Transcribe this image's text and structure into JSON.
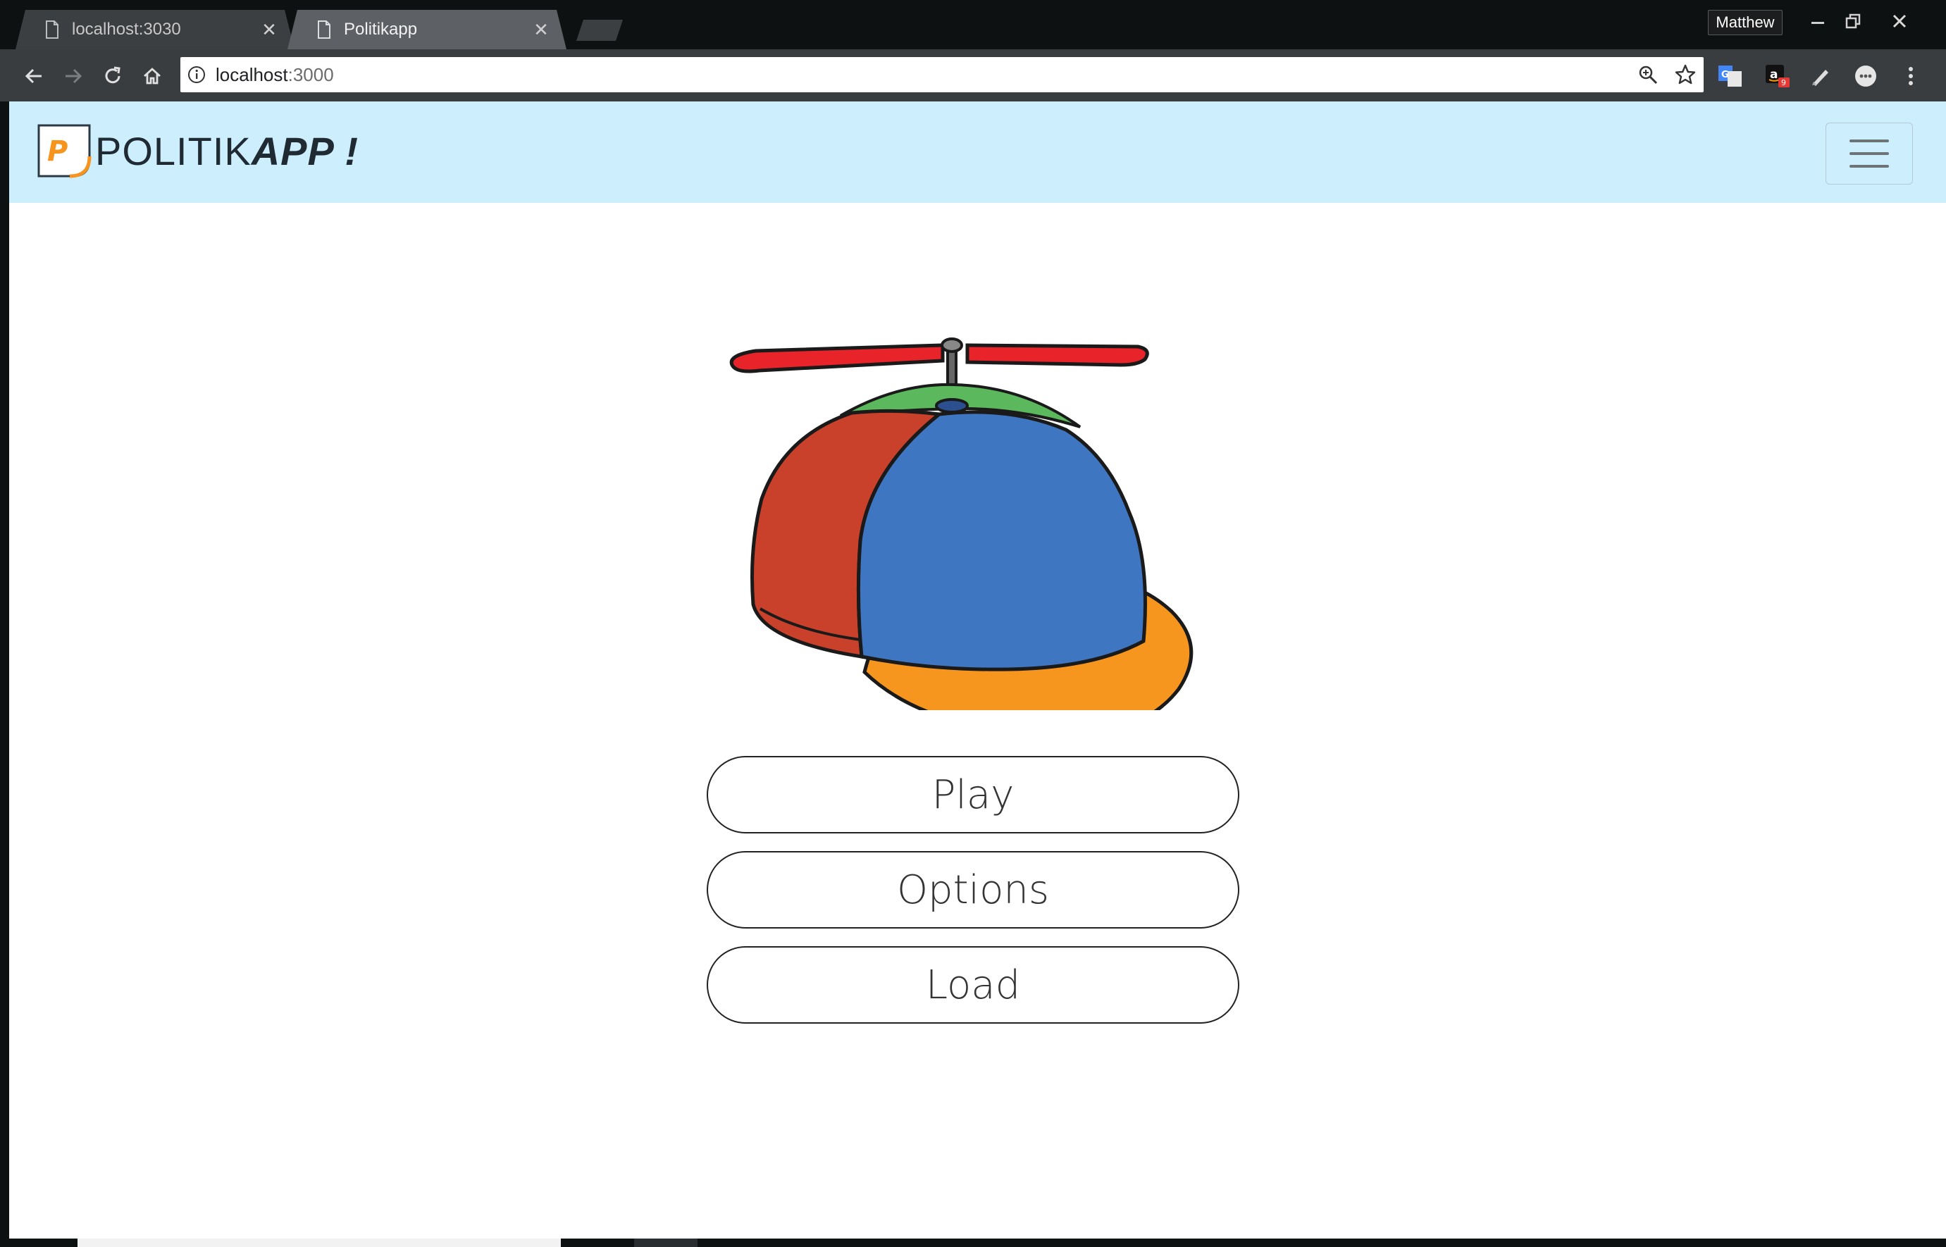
{
  "browser": {
    "tabs": [
      {
        "title": "localhost:3030",
        "active": false
      },
      {
        "title": "Politikapp",
        "active": true
      }
    ],
    "profile_name": "Matthew",
    "url_host": "localhost",
    "url_port": ":3000",
    "extension_badge": "9",
    "icons": [
      "back-icon",
      "forward-icon",
      "reload-icon",
      "home-icon",
      "info-icon",
      "zoom-icon",
      "star-icon",
      "translate-icon",
      "amazon-icon",
      "pen-icon",
      "chat-icon",
      "menu-dots-icon"
    ]
  },
  "navbar": {
    "brand_light": "POLITIK",
    "brand_bold": "APP !",
    "logo_letter": "P",
    "colors": {
      "background": "#cdeefd",
      "logo_accent": "#f7941d"
    }
  },
  "hero": {
    "image_subject": "propeller-beanie-cap",
    "colors": {
      "propeller": "#e8232a",
      "left_panel": "#c9412a",
      "center_panel": "#3f76c1",
      "top_panel": "#5cb85c",
      "brim": "#f7961f"
    }
  },
  "menu": {
    "play_label": "Play",
    "options_label": "Options",
    "load_label": "Load"
  }
}
